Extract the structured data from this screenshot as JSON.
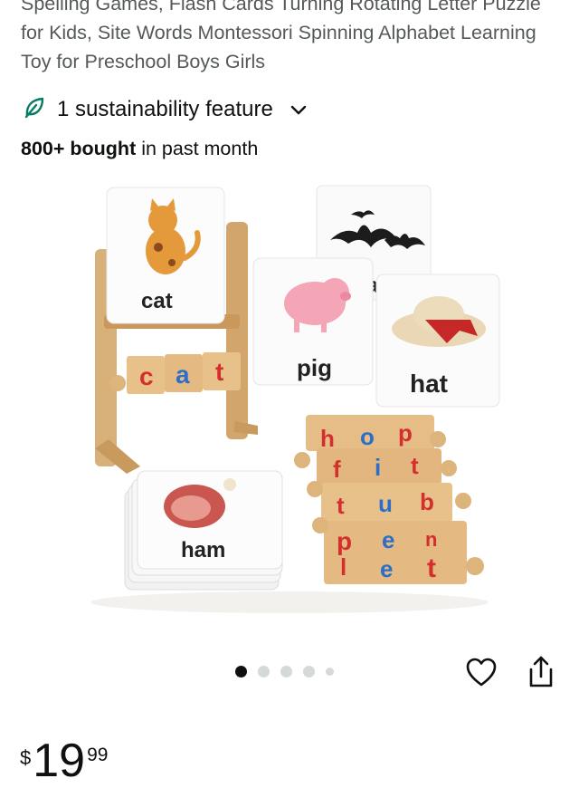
{
  "product": {
    "title": "Spelling Games, Flash Cards Turning Rotating Letter Puzzle for Kids, Site Words Montessori Spinning Alphabet Learning Toy for Preschool Boys Girls",
    "sustainability_label": "1 sustainability feature",
    "bought_count": "800+ bought",
    "bought_suffix": " in past month"
  },
  "image": {
    "card_words": [
      "cat",
      "pig",
      "hat",
      "ham",
      "a"
    ],
    "block_row_letters": [
      "c",
      "a",
      "t"
    ],
    "spinner_rows": [
      [
        "h",
        "o",
        "p"
      ],
      [
        "f",
        "i",
        "t"
      ],
      [
        "t",
        "u",
        "b"
      ],
      [
        "p",
        "e",
        "n"
      ]
    ],
    "spinner_lower_letters": [
      "l",
      "e",
      "t"
    ]
  },
  "carousel": {
    "total": 5,
    "active_index": 0
  },
  "price": {
    "symbol": "$",
    "whole": "19",
    "fraction": "99"
  },
  "colors": {
    "leaf_green": "#067d62",
    "letter_red": "#d32f2f",
    "letter_blue": "#2c6fc9"
  },
  "icons": {
    "sustainability": "leaf-icon",
    "expand": "chevron-down-icon",
    "wishlist": "heart-icon",
    "share": "share-icon"
  }
}
